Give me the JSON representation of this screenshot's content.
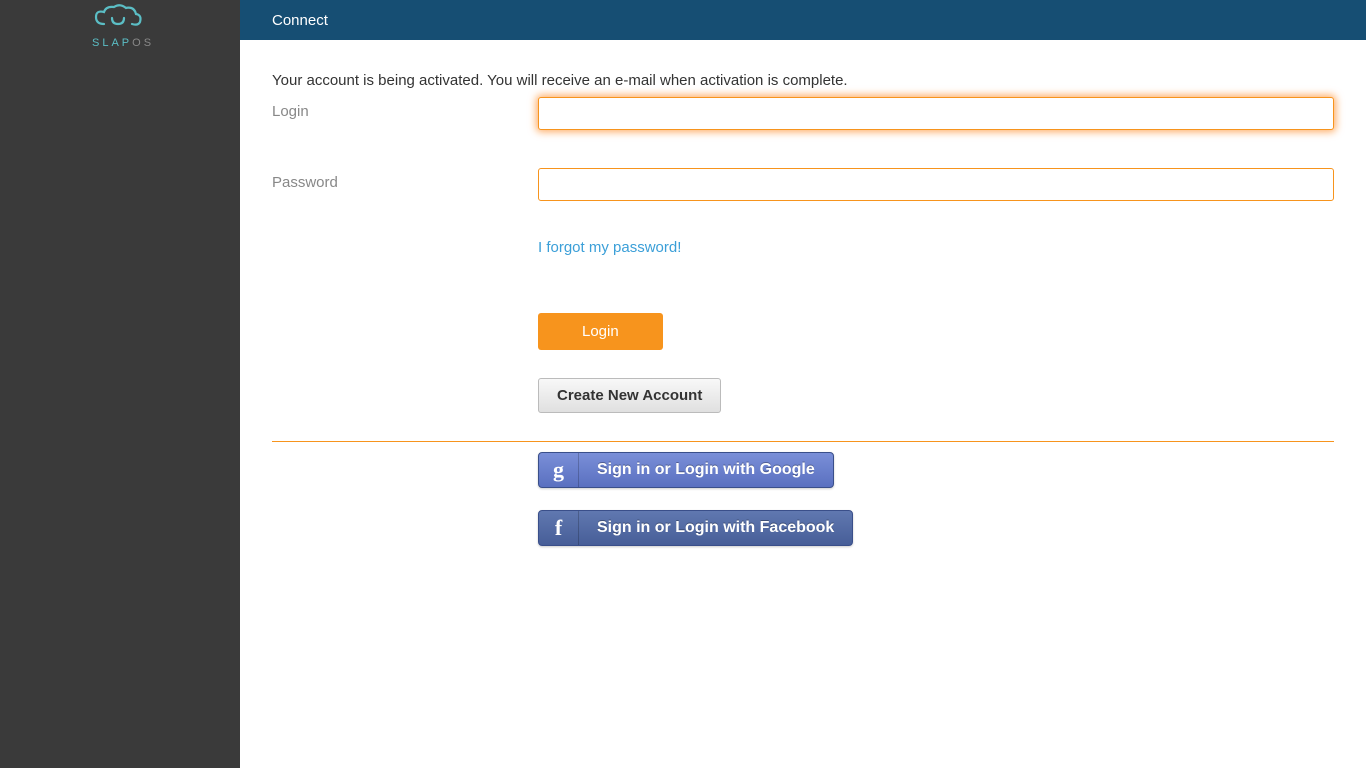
{
  "sidebar": {
    "logo_text_main": "SLAP",
    "logo_text_suffix": "OS"
  },
  "header": {
    "title": "Connect"
  },
  "main": {
    "activation_notice": "Your account is being activated. You will receive an e-mail when activation is complete.",
    "login_label": "Login",
    "password_label": "Password",
    "login_value": "",
    "password_value": "",
    "forgot_link": "I forgot my password!",
    "login_button": "Login",
    "create_account_button": "Create New Account",
    "google_button": "Sign in or Login with Google",
    "facebook_button": "Sign in or Login with Facebook"
  }
}
